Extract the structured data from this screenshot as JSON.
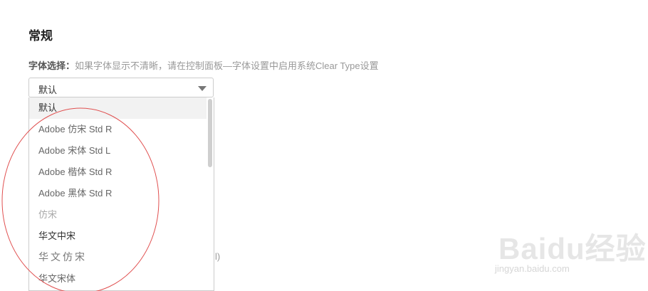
{
  "general": {
    "title": "常规",
    "font_label": "字体选择：",
    "font_hint": "如果字体显示不清晰，请在控制面板—字体设置中启用系统Clear Type设置",
    "selected_value": "默认"
  },
  "dropdown": {
    "options": [
      "默认",
      "Adobe 仿宋 Std R",
      "Adobe 宋体 Std L",
      "Adobe 楷体 Std R",
      "Adobe 黑体 Std R",
      "仿宋",
      "华文中宋",
      "华文仿宋",
      "华文宋体"
    ],
    "highlighted_index": 0
  },
  "background_fragment": "l)",
  "colors": {
    "annotation_circle": "#e05050",
    "highlight_row": "#f2f2f2",
    "watermark": "#e6e6e6"
  },
  "watermark": {
    "logo_text": "Baidu经验",
    "url": "jingyan.baidu.com"
  }
}
